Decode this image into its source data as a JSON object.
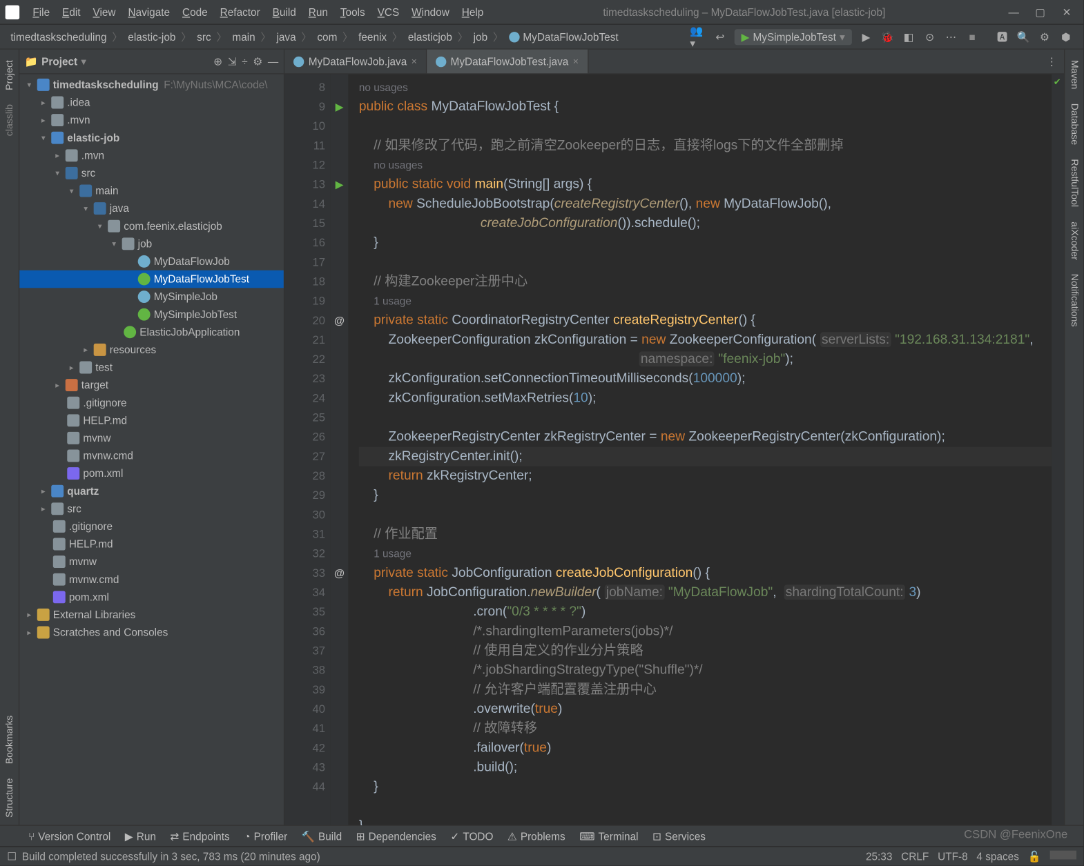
{
  "window": {
    "title": "timedtaskscheduling – MyDataFlowJobTest.java [elastic-job]"
  },
  "menus": [
    "File",
    "Edit",
    "View",
    "Navigate",
    "Code",
    "Refactor",
    "Build",
    "Run",
    "Tools",
    "VCS",
    "Window",
    "Help"
  ],
  "breadcrumbs": [
    "timedtaskscheduling",
    "elastic-job",
    "src",
    "main",
    "java",
    "com",
    "feenix",
    "elasticjob",
    "job",
    "MyDataFlowJobTest"
  ],
  "run_config": "MySimpleJobTest",
  "project_panel": {
    "title": "Project",
    "root_hint": "F:\\MyNuts\\MCA\\code\\"
  },
  "tree": {
    "root": "timedtaskscheduling",
    "items": [
      {
        "l": 1,
        "icon": "folder",
        "label": ".idea",
        "arrow": ">"
      },
      {
        "l": 1,
        "icon": "folder",
        "label": ".mvn",
        "arrow": ">"
      },
      {
        "l": 1,
        "icon": "folder-mod",
        "label": "elastic-job",
        "arrow": "v",
        "bold": true
      },
      {
        "l": 2,
        "icon": "folder",
        "label": ".mvn",
        "arrow": ">"
      },
      {
        "l": 2,
        "icon": "folder-src",
        "label": "src",
        "arrow": "v"
      },
      {
        "l": 3,
        "icon": "folder-src",
        "label": "main",
        "arrow": "v"
      },
      {
        "l": 4,
        "icon": "folder-src",
        "label": "java",
        "arrow": "v"
      },
      {
        "l": 5,
        "icon": "folder",
        "label": "com.feenix.elasticjob",
        "arrow": "v"
      },
      {
        "l": 6,
        "icon": "folder",
        "label": "job",
        "arrow": "v"
      },
      {
        "l": 7,
        "icon": "java-class",
        "label": "MyDataFlowJob"
      },
      {
        "l": 7,
        "icon": "java-run",
        "label": "MyDataFlowJobTest",
        "selected": true
      },
      {
        "l": 7,
        "icon": "java-class",
        "label": "MySimpleJob"
      },
      {
        "l": 7,
        "icon": "java-run",
        "label": "MySimpleJobTest"
      },
      {
        "l": 6,
        "icon": "java-run",
        "label": "ElasticJobApplication"
      },
      {
        "l": 4,
        "icon": "folder-res",
        "label": "resources",
        "arrow": ">"
      },
      {
        "l": 3,
        "icon": "folder",
        "label": "test",
        "arrow": ">"
      },
      {
        "l": 2,
        "icon": "folder-target",
        "label": "target",
        "arrow": ">"
      },
      {
        "l": 2,
        "icon": "file-txt",
        "label": ".gitignore"
      },
      {
        "l": 2,
        "icon": "file-txt",
        "label": "HELP.md"
      },
      {
        "l": 2,
        "icon": "file-txt",
        "label": "mvnw"
      },
      {
        "l": 2,
        "icon": "file-txt",
        "label": "mvnw.cmd"
      },
      {
        "l": 2,
        "icon": "file-m",
        "label": "pom.xml"
      },
      {
        "l": 1,
        "icon": "folder-mod",
        "label": "quartz",
        "arrow": ">",
        "bold": true
      },
      {
        "l": 1,
        "icon": "folder",
        "label": "src",
        "arrow": ">"
      },
      {
        "l": 1,
        "icon": "file-txt",
        "label": ".gitignore"
      },
      {
        "l": 1,
        "icon": "file-txt",
        "label": "HELP.md"
      },
      {
        "l": 1,
        "icon": "file-txt",
        "label": "mvnw"
      },
      {
        "l": 1,
        "icon": "file-txt",
        "label": "mvnw.cmd"
      },
      {
        "l": 1,
        "icon": "file-m",
        "label": "pom.xml"
      },
      {
        "l": 0,
        "icon": "file-lib",
        "label": "External Libraries",
        "arrow": ">"
      },
      {
        "l": 0,
        "icon": "file-lib",
        "label": "Scratches and Consoles",
        "arrow": ">"
      }
    ]
  },
  "tabs": [
    {
      "name": "MyDataFlowJob.java",
      "active": false
    },
    {
      "name": "MyDataFlowJobTest.java",
      "active": true
    }
  ],
  "code_lines": [
    {
      "n": 8,
      "html": "<span class='usage'>no usages</span>"
    },
    {
      "n": 9,
      "mark": "run",
      "html": "<span class='kw'>public</span> <span class='kw'>class</span> <span class='cls'>MyDataFlowJobTest</span> {"
    },
    {
      "n": 10,
      "html": ""
    },
    {
      "n": 11,
      "html": "    <span class='cmt'>// 如果修改了代码，跑之前清空Zookeeper的日志，直接将logs下的文件全部删掉</span>"
    },
    {
      "n": "",
      "html": "    <span class='usage'>no usages</span>"
    },
    {
      "n": 12,
      "mark": "run",
      "html": "    <span class='kw'>public</span> <span class='kw'>static</span> <span class='kw'>void</span> <span class='fn'>main</span>(String[] args) {"
    },
    {
      "n": 13,
      "html": "        <span class='kw'>new</span> ScheduleJobBootstrap(<span class='fni'>createRegistryCenter</span>(), <span class='kw'>new</span> MyDataFlowJob(),"
    },
    {
      "n": 14,
      "html": "                                 <span class='fni'>createJobConfiguration</span>()).schedule();"
    },
    {
      "n": 15,
      "html": "    }"
    },
    {
      "n": 16,
      "html": ""
    },
    {
      "n": 17,
      "html": "    <span class='cmt'>// 构建Zookeeper注册中心</span>"
    },
    {
      "n": "",
      "html": "    <span class='usage'>1 usage</span>"
    },
    {
      "n": 18,
      "mark": "anno",
      "html": "    <span class='kw'>private</span> <span class='kw'>static</span> CoordinatorRegistryCenter <span class='fn'>createRegistryCenter</span>() {"
    },
    {
      "n": 19,
      "html": "        ZookeeperConfiguration zkConfiguration = <span class='kw'>new</span> ZookeeperConfiguration( <span class='hint'>serverLists:</span> <span class='str'>\"192.168.31.134:2181\"</span>,"
    },
    {
      "n": 20,
      "html": "                                                                            <span class='hint'>namespace:</span> <span class='str'>\"feenix-job\"</span>);"
    },
    {
      "n": 21,
      "html": "        zkConfiguration.setConnectionTimeoutMilliseconds(<span class='num'>100000</span>);"
    },
    {
      "n": 22,
      "html": "        zkConfiguration.setMaxRetries(<span class='num'>10</span>);"
    },
    {
      "n": 23,
      "html": ""
    },
    {
      "n": 24,
      "html": "        ZookeeperRegistryCenter zkRegistryCenter = <span class='kw'>new</span> ZookeeperRegistryCenter(zkConfiguration);"
    },
    {
      "n": 25,
      "hl": true,
      "html": "        zkRegistryCenter.init();"
    },
    {
      "n": 26,
      "html": "        <span class='kw'>return</span> zkRegistryCenter;"
    },
    {
      "n": 27,
      "html": "    }"
    },
    {
      "n": 28,
      "html": ""
    },
    {
      "n": 29,
      "html": "    <span class='cmt'>// 作业配置</span>"
    },
    {
      "n": "",
      "html": "    <span class='usage'>1 usage</span>"
    },
    {
      "n": 30,
      "mark": "anno",
      "html": "    <span class='kw'>private</span> <span class='kw'>static</span> JobConfiguration <span class='fn'>createJobConfiguration</span>() {"
    },
    {
      "n": 31,
      "html": "        <span class='kw'>return</span> JobConfiguration.<span class='fni'>newBuilder</span>( <span class='hint'>jobName:</span> <span class='str'>\"MyDataFlowJob\"</span>,  <span class='hint'>shardingTotalCount:</span> <span class='num'>3</span>)"
    },
    {
      "n": 32,
      "html": "                               .cron(<span class='str'>\"0/3 * * * * ?\"</span>)"
    },
    {
      "n": 33,
      "html": "                               <span class='cmt'>/*.shardingItemParameters(jobs)*/</span>"
    },
    {
      "n": 34,
      "html": "                               <span class='cmt'>// 使用自定义的作业分片策略</span>"
    },
    {
      "n": 35,
      "html": "                               <span class='cmt'>/*.jobShardingStrategyType(\"Shuffle\")*/</span>"
    },
    {
      "n": 36,
      "html": "                               <span class='cmt'>// 允许客户端配置覆盖注册中心</span>"
    },
    {
      "n": 37,
      "html": "                               .overwrite(<span class='kw'>true</span>)"
    },
    {
      "n": 38,
      "html": "                               <span class='cmt'>// 故障转移</span>"
    },
    {
      "n": 39,
      "html": "                               .failover(<span class='kw'>true</span>)"
    },
    {
      "n": 40,
      "html": "                               .build();"
    },
    {
      "n": 41,
      "html": "    }"
    },
    {
      "n": 42,
      "html": ""
    },
    {
      "n": 43,
      "html": "}"
    },
    {
      "n": 44,
      "html": ""
    }
  ],
  "bottom": [
    "Version Control",
    "Run",
    "Endpoints",
    "Profiler",
    "Build",
    "Dependencies",
    "TODO",
    "Problems",
    "Terminal",
    "Services"
  ],
  "status": {
    "msg": "Build completed successfully in 3 sec, 783 ms (20 minutes ago)",
    "pos": "25:33",
    "eol": "CRLF",
    "enc": "UTF-8",
    "indent": "4 spaces"
  },
  "right_tabs": [
    "Maven",
    "Database",
    "RestfulTool",
    "aiXcoder",
    "Notifications"
  ],
  "left_tabs_top": [
    "Project"
  ],
  "left_tabs_bottom": [
    "Bookmarks",
    "Structure"
  ],
  "watermark": "CSDN @FeenixOne"
}
